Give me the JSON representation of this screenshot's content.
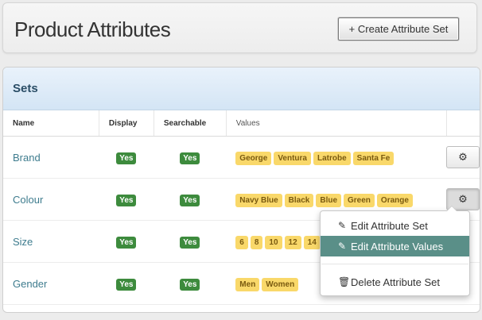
{
  "header": {
    "title": "Product Attributes",
    "create_button": "+ Create Attribute Set"
  },
  "panel": {
    "title": "Sets",
    "columns": [
      "Name",
      "Display",
      "Searchable",
      "Values"
    ],
    "rows": [
      {
        "name": "Brand",
        "display": "Yes",
        "searchable": "Yes",
        "values": [
          "George",
          "Ventura",
          "Latrobe",
          "Santa Fe"
        ]
      },
      {
        "name": "Colour",
        "display": "Yes",
        "searchable": "Yes",
        "values": [
          "Navy Blue",
          "Black",
          "Blue",
          "Green",
          "Orange"
        ]
      },
      {
        "name": "Size",
        "display": "Yes",
        "searchable": "Yes",
        "values": [
          "6",
          "8",
          "10",
          "12",
          "14"
        ]
      },
      {
        "name": "Gender",
        "display": "Yes",
        "searchable": "Yes",
        "values": [
          "Men",
          "Women"
        ]
      }
    ]
  },
  "menu": {
    "items": [
      {
        "label": "Edit Attribute Set",
        "icon": "edit-icon"
      },
      {
        "label": "Edit Attribute Values",
        "icon": "edit-icon"
      },
      {
        "label": "Delete Attribute Set",
        "icon": "trash-icon"
      }
    ]
  },
  "colors": {
    "yes_badge": "#3d8b3d",
    "value_tag": "#f9d86a",
    "highlight": "#5a8f88",
    "link": "#3e7c8e"
  }
}
